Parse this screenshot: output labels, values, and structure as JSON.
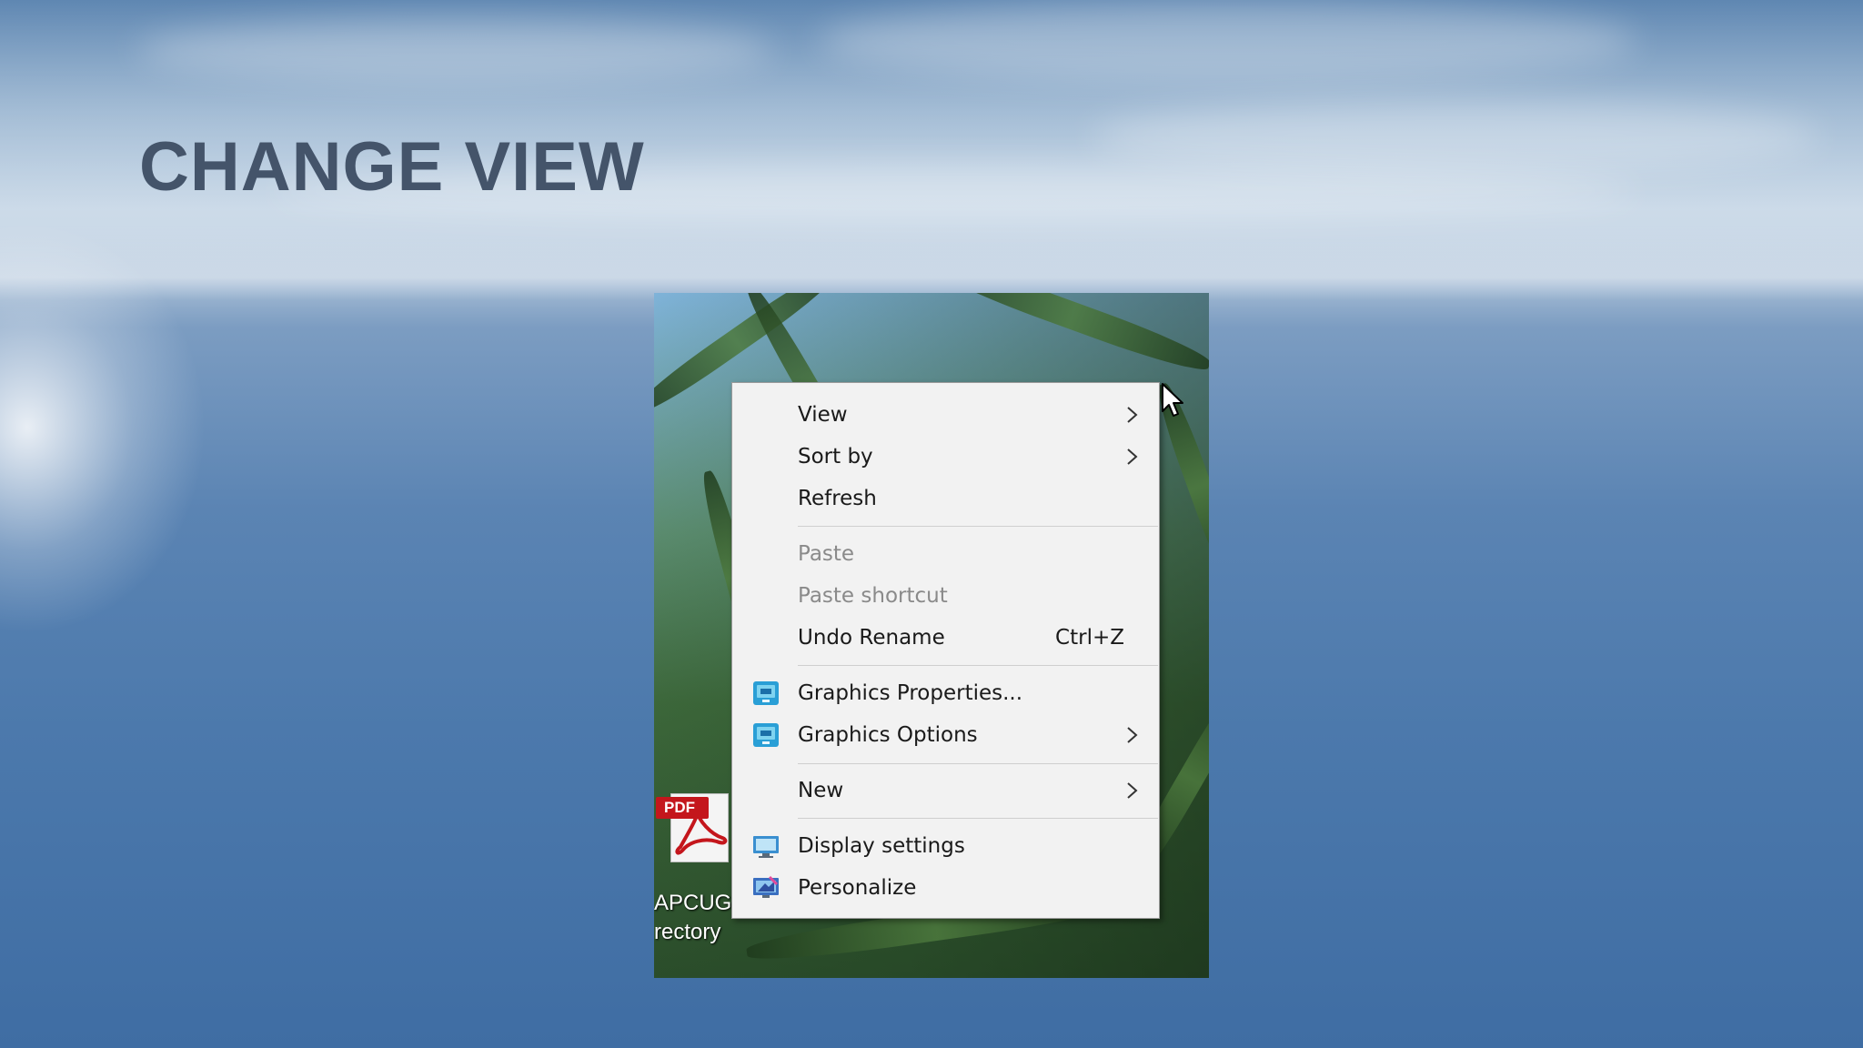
{
  "slide": {
    "title": "CHANGE VIEW"
  },
  "desktop_icon": {
    "badge": "PDF",
    "label": "APCUG\nrectory"
  },
  "context_menu": {
    "items": [
      {
        "label": "View",
        "submenu": true
      },
      {
        "label": "Sort by",
        "submenu": true
      },
      {
        "label": "Refresh"
      },
      {
        "label": "Paste",
        "disabled": true
      },
      {
        "label": "Paste shortcut",
        "disabled": true
      },
      {
        "label": "Undo Rename",
        "shortcut": "Ctrl+Z"
      },
      {
        "label": "Graphics Properties...",
        "icon": "graphics-properties-icon"
      },
      {
        "label": "Graphics Options",
        "icon": "graphics-options-icon",
        "submenu": true
      },
      {
        "label": "New",
        "submenu": true
      },
      {
        "label": "Display settings",
        "icon": "display-settings-icon"
      },
      {
        "label": "Personalize",
        "icon": "personalize-icon"
      }
    ]
  },
  "colors": {
    "title": "#44546a",
    "menu_background": "#f2f2f2",
    "disabled_text": "#8a8a8a",
    "pdf_red": "#c4161c"
  }
}
